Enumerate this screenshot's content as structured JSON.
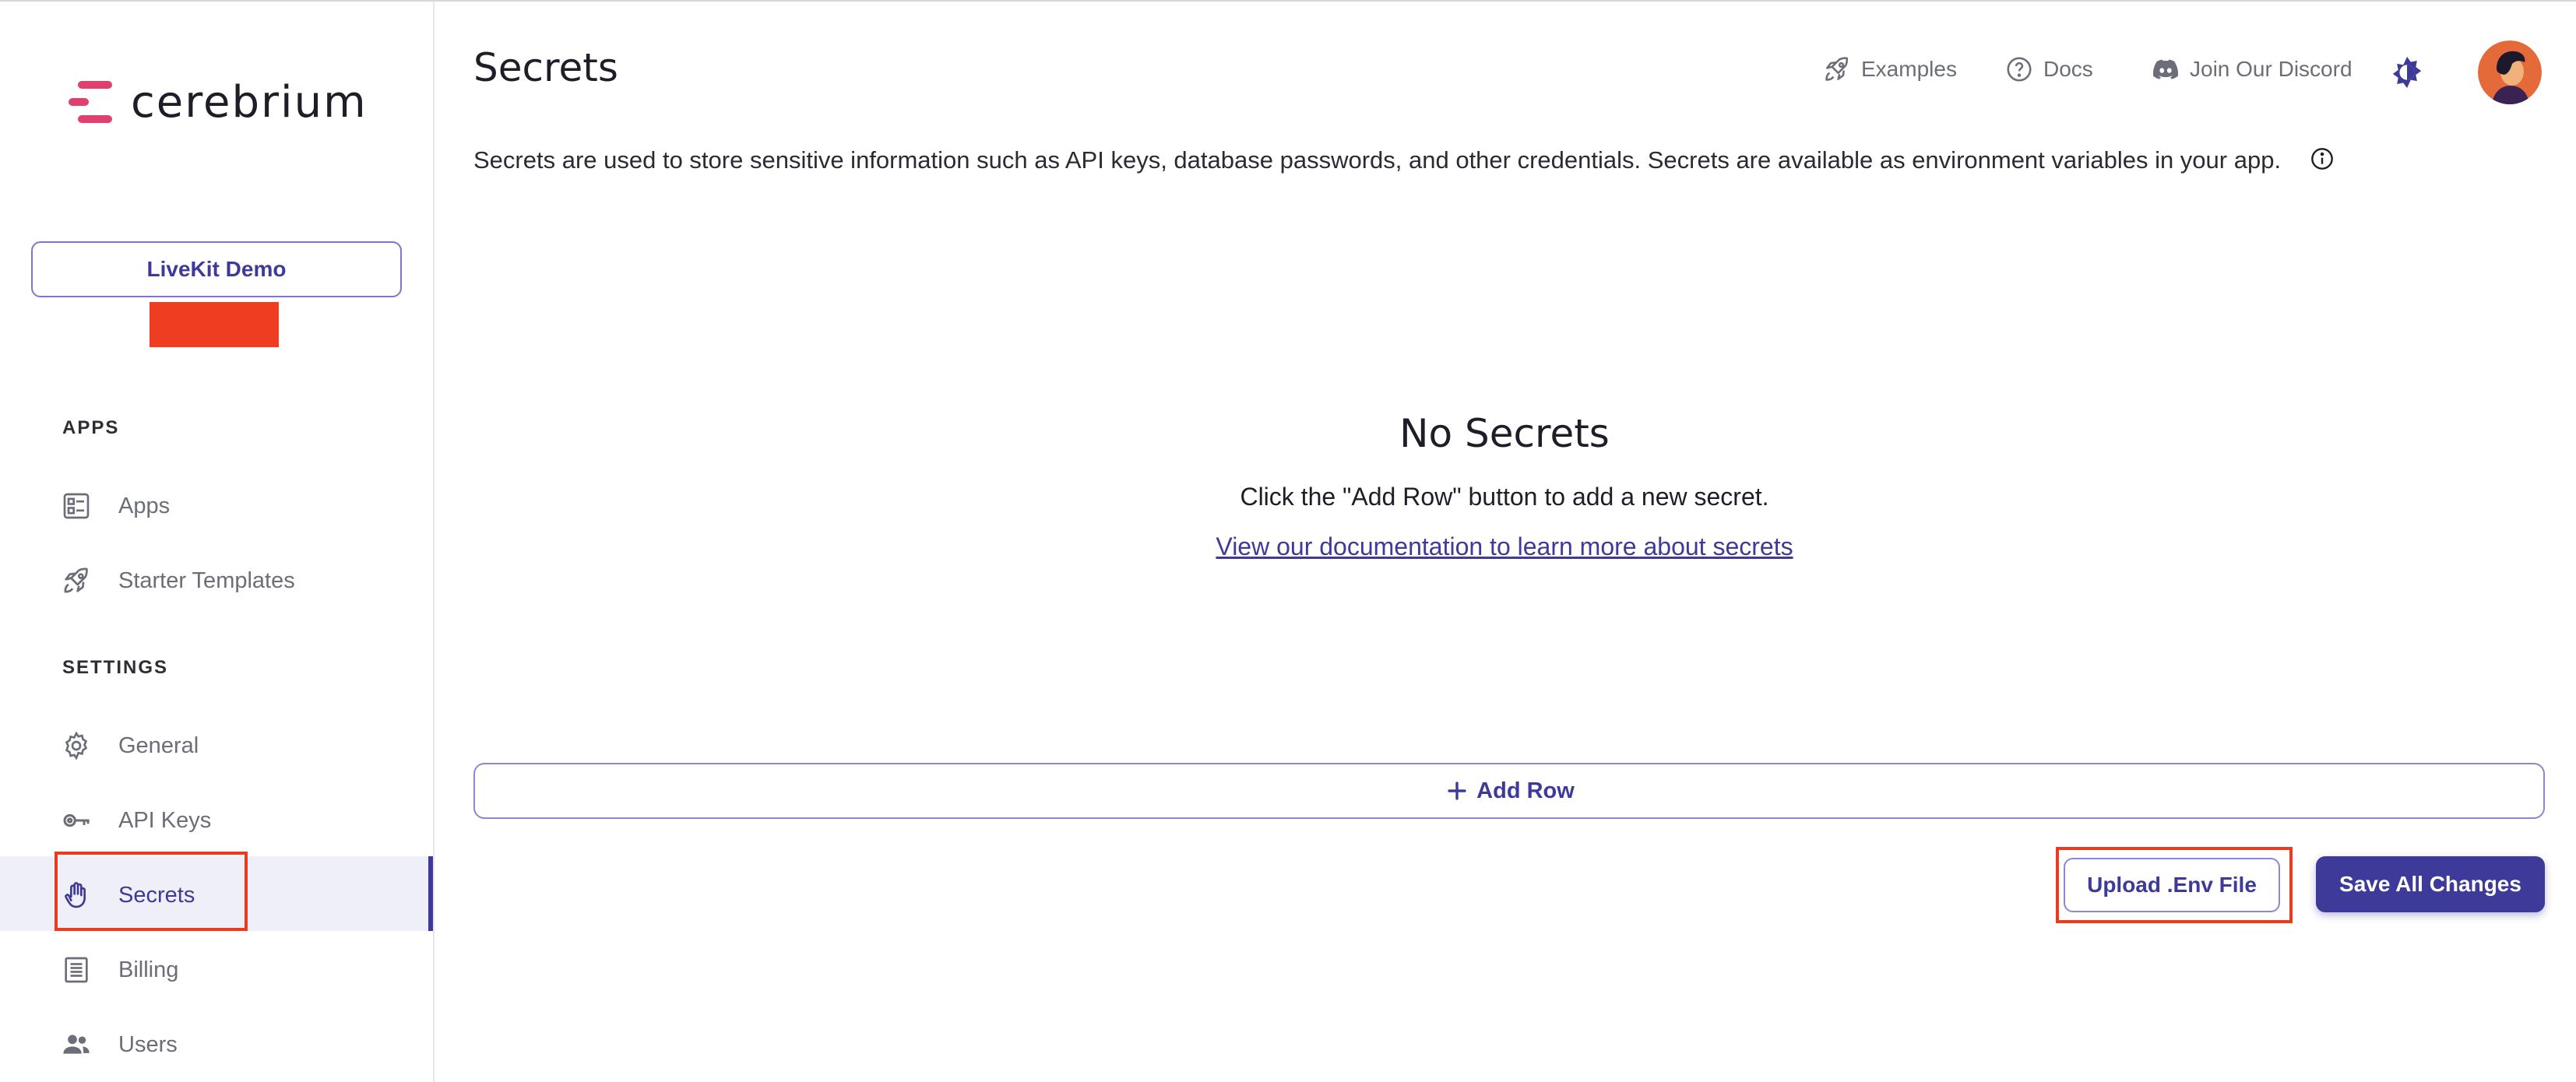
{
  "brand": {
    "name": "cerebrium",
    "accent": "#3e3a9a",
    "logo_color": "#e0406e"
  },
  "sidebar": {
    "project": "LiveKit Demo",
    "sections": [
      {
        "label": "APPS",
        "items": [
          {
            "label": "Apps",
            "icon": "apps-list-icon"
          },
          {
            "label": "Starter Templates",
            "icon": "rocket-icon"
          }
        ]
      },
      {
        "label": "SETTINGS",
        "items": [
          {
            "label": "General",
            "icon": "gear-icon"
          },
          {
            "label": "API Keys",
            "icon": "key-icon"
          },
          {
            "label": "Secrets",
            "icon": "hand-icon",
            "active": true
          },
          {
            "label": "Billing",
            "icon": "receipt-icon"
          },
          {
            "label": "Users",
            "icon": "users-icon"
          }
        ]
      }
    ]
  },
  "header": {
    "title": "Secrets",
    "nav": [
      {
        "label": "Examples",
        "icon": "rocket-icon"
      },
      {
        "label": "Docs",
        "icon": "question-circle-icon"
      },
      {
        "label": "Join Our Discord",
        "icon": "discord-icon"
      }
    ]
  },
  "main": {
    "description": "Secrets are used to store sensitive information such as API keys, database passwords, and other credentials. Secrets are available as environment variables in your app.",
    "empty_title": "No Secrets",
    "empty_subtitle": "Click the \"Add Row\" button to add a new secret.",
    "empty_link": "View our documentation to learn more about secrets",
    "add_row_label": "Add Row",
    "upload_label": "Upload .Env File",
    "save_label": "Save All Changes"
  }
}
